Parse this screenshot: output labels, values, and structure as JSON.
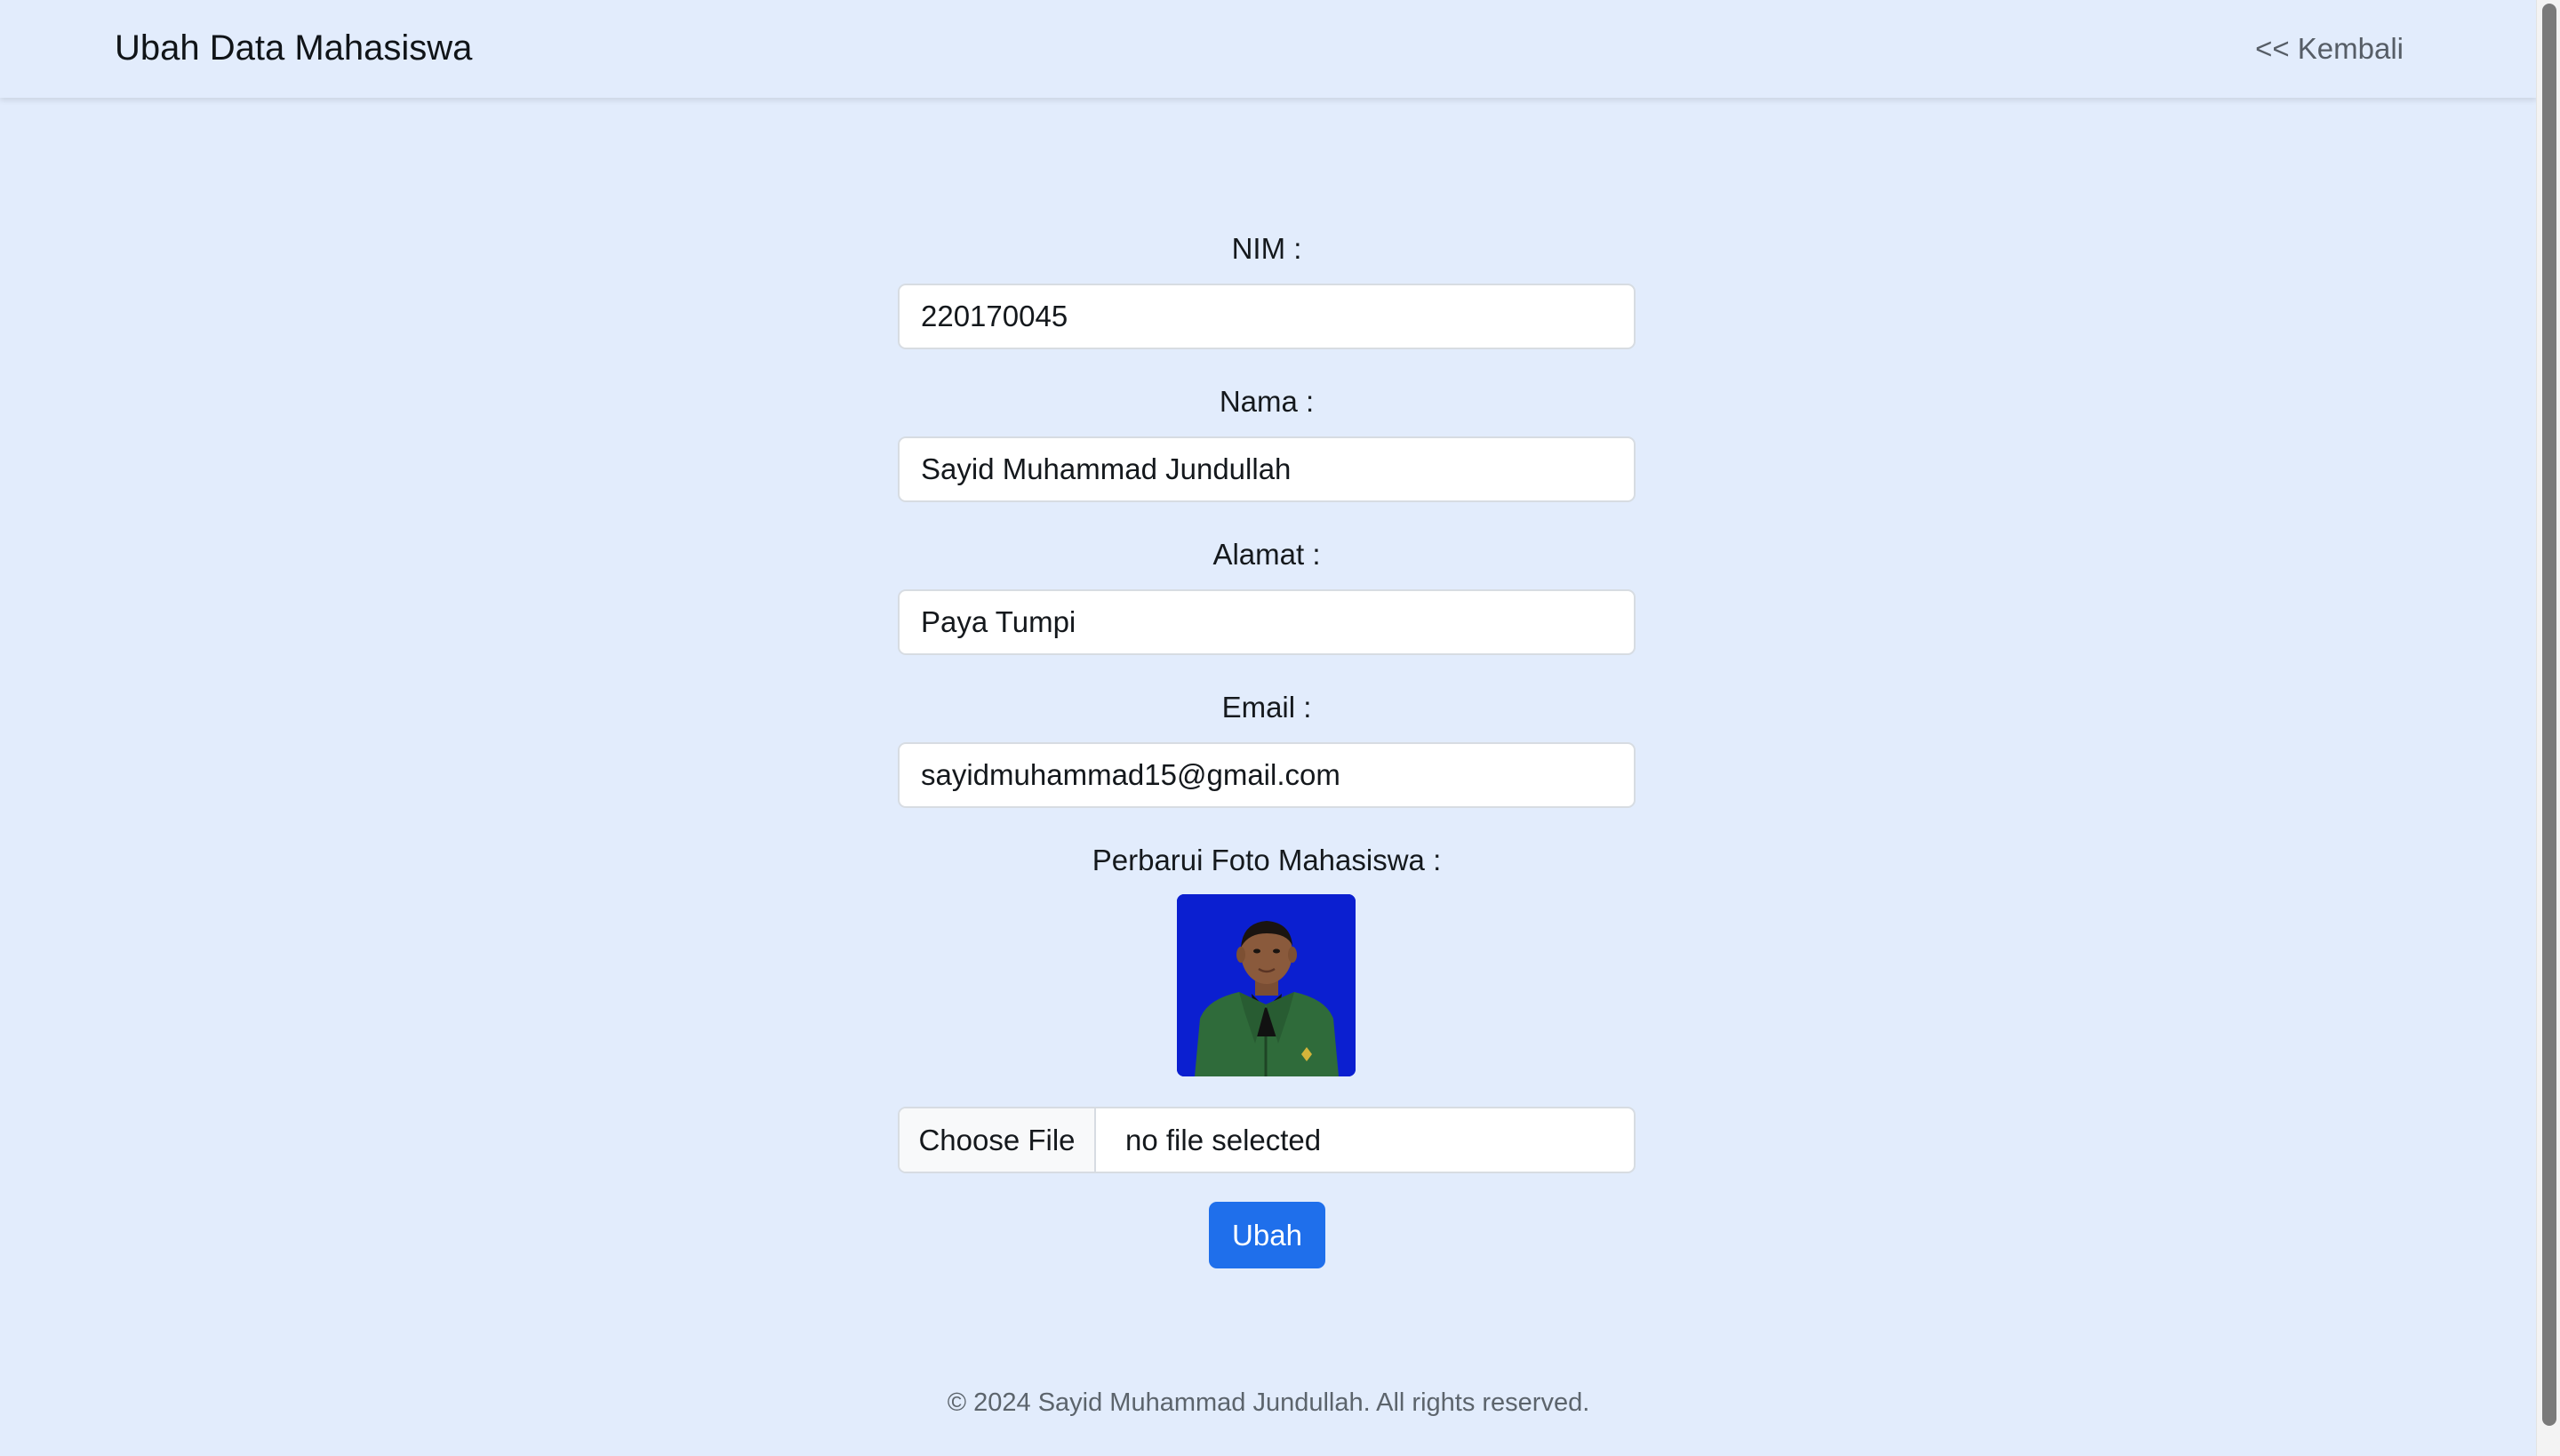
{
  "header": {
    "title": "Ubah Data Mahasiswa",
    "back_link": "<< Kembali"
  },
  "form": {
    "nim": {
      "label": "NIM :",
      "value": "220170045"
    },
    "nama": {
      "label": "Nama :",
      "value": "Sayid Muhammad Jundullah"
    },
    "alamat": {
      "label": "Alamat :",
      "value": "Paya Tumpi"
    },
    "email": {
      "label": "Email :",
      "value": "sayidmuhammad15@gmail.com"
    },
    "foto": {
      "label": "Perbarui Foto Mahasiswa :",
      "choose_file_label": "Choose File",
      "file_status": "no file selected"
    },
    "submit_label": "Ubah"
  },
  "footer": {
    "text": "© 2024 Sayid Muhammad Jundullah. All rights reserved."
  },
  "colors": {
    "background": "#e2ecfc",
    "primary_button": "#1f6feb",
    "photo_background": "#0b1fd0"
  }
}
